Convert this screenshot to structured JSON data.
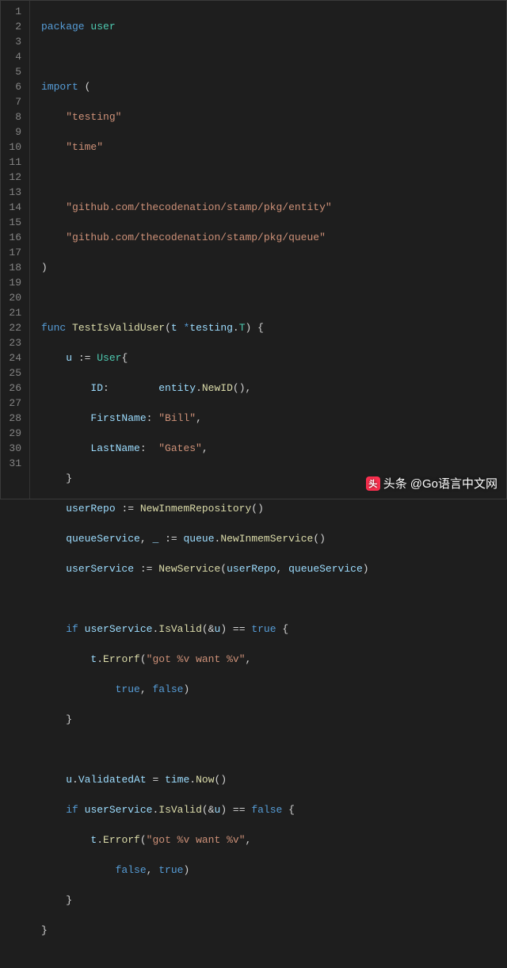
{
  "lineCount": 31,
  "code": {
    "l1": {
      "kw1": "package",
      "pkg": "user"
    },
    "l3": {
      "kw1": "import"
    },
    "l4": {
      "s": "\"testing\""
    },
    "l5": {
      "s": "\"time\""
    },
    "l7": {
      "s": "\"github.com/thecodenation/stamp/pkg/entity\""
    },
    "l8": {
      "s": "\"github.com/thecodenation/stamp/pkg/queue\""
    },
    "l11": {
      "kw1": "func",
      "fn": "TestIsValidUser",
      "id": "t",
      "ptr": "*",
      "type": "testing",
      "sub": "T"
    },
    "l12": {
      "id": "u",
      "type": "User"
    },
    "l13": {
      "id": "ID",
      "pkg": "entity",
      "fn": "NewID"
    },
    "l14": {
      "id": "FirstName",
      "s": "\"Bill\""
    },
    "l15": {
      "id": "LastName",
      "s": "\"Gates\""
    },
    "l17": {
      "id": "userRepo",
      "fn": "NewInmemRepository"
    },
    "l18": {
      "id": "queueService",
      "blank": "_",
      "pkg": "queue",
      "fn": "NewInmemService"
    },
    "l19": {
      "id": "userService",
      "fn": "NewService",
      "a1": "userRepo",
      "a2": "queueService"
    },
    "l21": {
      "kw": "if",
      "id": "userService",
      "fn": "IsValid",
      "arg": "u",
      "c": "true"
    },
    "l22": {
      "id": "t",
      "fn": "Errorf",
      "s": "\"got %v want %v\""
    },
    "l23": {
      "c1": "true",
      "c2": "false"
    },
    "l26": {
      "id": "u",
      "fld": "ValidatedAt",
      "pkg": "time",
      "fn": "Now"
    },
    "l27": {
      "kw": "if",
      "id": "userService",
      "fn": "IsValid",
      "arg": "u",
      "c": "false"
    },
    "l28": {
      "id": "t",
      "fn": "Errorf",
      "s": "\"got %v want %v\""
    },
    "l29": {
      "c1": "false",
      "c2": "true"
    }
  },
  "watermark": {
    "prefix": "头条",
    "handle": "@Go语言中文网",
    "iconText": "头"
  }
}
